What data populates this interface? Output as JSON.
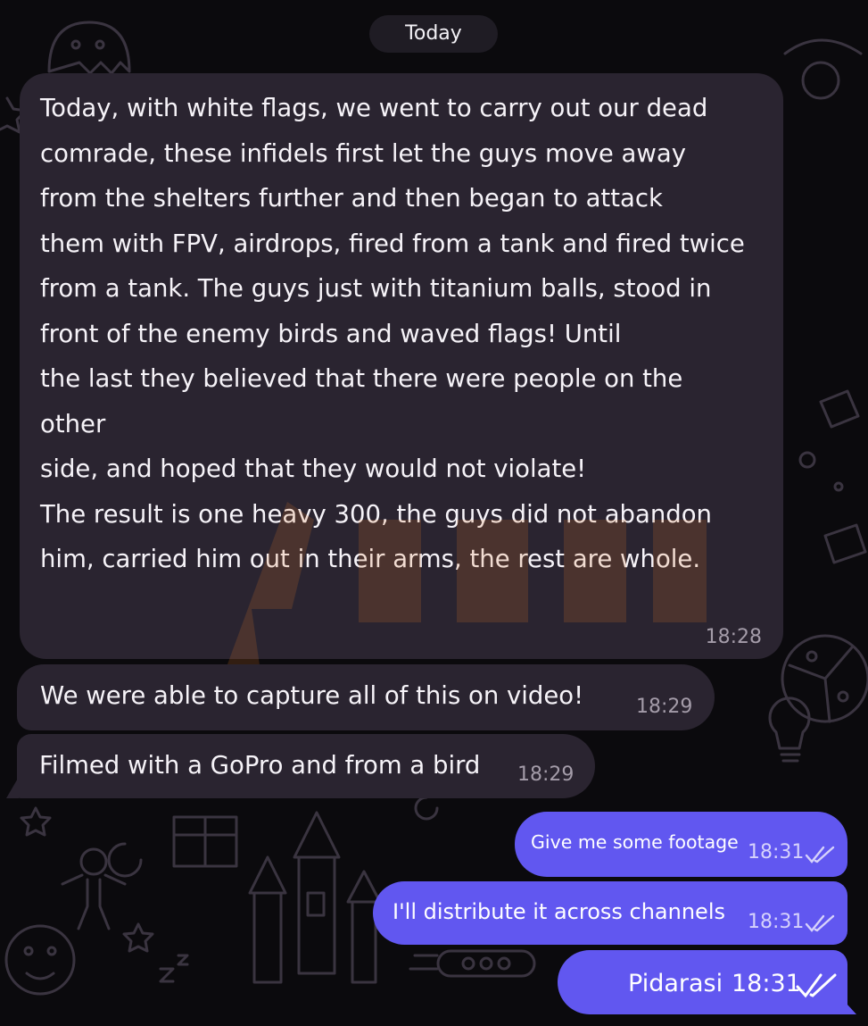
{
  "date_separator": "Today",
  "messages": [
    {
      "direction": "incoming",
      "text": "Today, with white flags, we went to carry out our dead\ncomrade, these infidels first let the guys move away\nfrom the shelters further and then began to attack\nthem with FPV, airdrops, fired from a tank and fired twice\nfrom a tank. The guys just with titanium balls, stood in\nfront of the enemy birds and waved flags! Until\nthe last they believed that there were people on the other\nside, and hoped that they would not violate!\nThe result is one heavy 300, the guys did not abandon\nhim, carried him out in their arms, the rest are whole.",
      "time": "18:28"
    },
    {
      "direction": "incoming",
      "text": "We were able to capture all of this on video!",
      "time": "18:29"
    },
    {
      "direction": "incoming",
      "text": "Filmed with a GoPro and from a bird",
      "time": "18:29"
    },
    {
      "direction": "outgoing",
      "text": "Give me some footage",
      "time": "18:31",
      "status": "read-double-check-icon"
    },
    {
      "direction": "outgoing",
      "text": "I'll distribute it across channels",
      "time": "18:31",
      "status": "read-double-check-icon"
    },
    {
      "direction": "outgoing",
      "text": "Pidarasi",
      "time": "18:31",
      "status": "read-double-check-icon"
    }
  ],
  "colors": {
    "background": "#0b0a0d",
    "incoming_bubble": "#2a2430",
    "outgoing_bubble": "#6157f0",
    "date_pill": "#1f1c24",
    "timestamp_incoming": "#a49ca9"
  },
  "watermark_icon": "lightning-watermark-logo"
}
